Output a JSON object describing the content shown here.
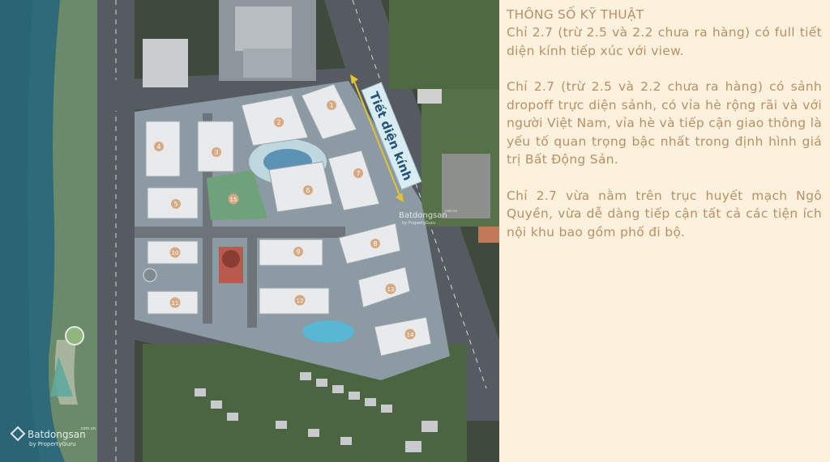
{
  "text_panel": {
    "heading": "THÔNG SỐ KỸ THUẬT",
    "paragraphs": [
      "Chỉ 2.7 (trừ 2.5 và 2.2 chưa ra hàng) có full tiết diện kính tiếp xúc với view.",
      "Chỉ 2.7 (trừ 2.5 và 2.2 chưa ra hàng) có sảnh dropoff trực diện sảnh, có vỉa hè rộng rãi và với người Việt Nam, vỉa hè và tiếp cận giao thông là yếu tố quan trọng bậc nhất trong định hình giá trị Bất Động Sản.",
      "Chỉ 2.7 vừa nằm trên trục huyết mạch Ngô Quyền, vừa dễ dàng tiếp cận tất cả các tiện ích nội khu bao gồm phố đi bộ."
    ]
  },
  "map": {
    "glass_facade_label": "Tiết diện kính",
    "building_numbers": [
      "1",
      "2",
      "3",
      "4",
      "5",
      "6",
      "7",
      "8",
      "9",
      "10",
      "11",
      "12",
      "13",
      "14",
      "15"
    ],
    "watermark_center": {
      "brand": "Batdongsan",
      "suffix": ".com.vn",
      "tagline": "by PropertyGuru"
    },
    "watermark_corner": {
      "brand": "Batdongsan",
      "suffix": ".com.vn",
      "tagline": "by PropertyGuru"
    }
  },
  "colors": {
    "text": "#b98f68",
    "panel_bg": "#fbf1dc",
    "river": "#2f6a7a",
    "label_bg": "#d9ecf2",
    "arrow": "#e3c233"
  }
}
